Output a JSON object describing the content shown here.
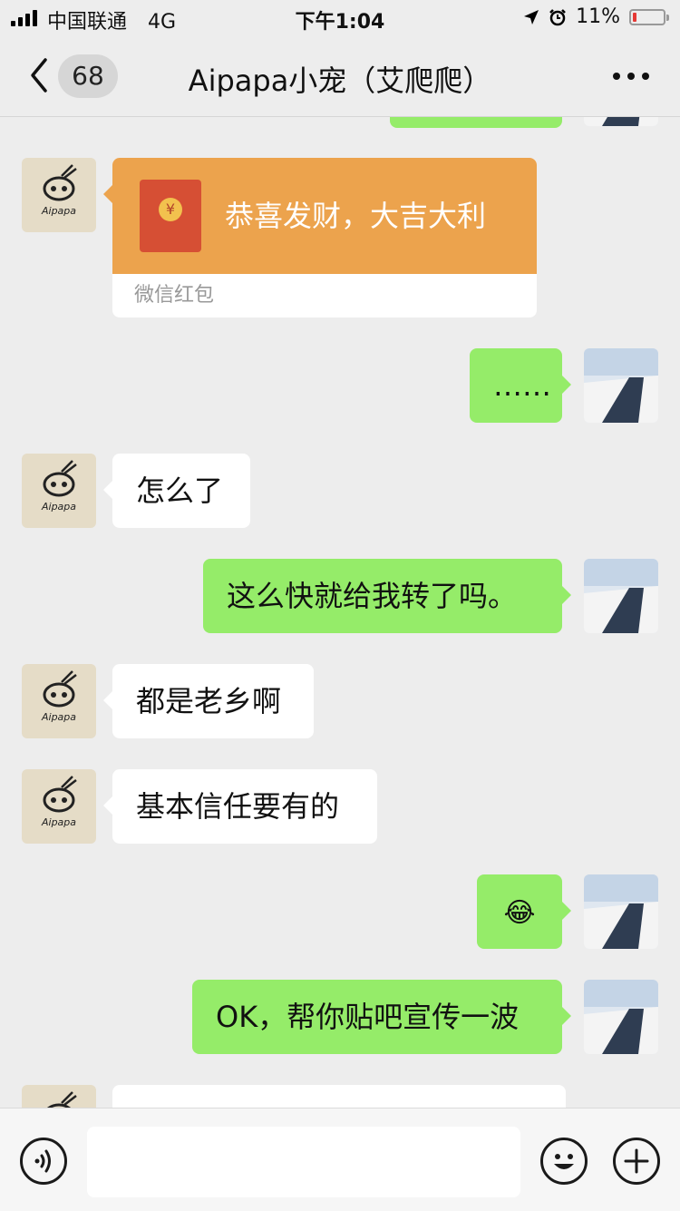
{
  "status_bar": {
    "carrier": "中国联通",
    "network": "4G",
    "time": "下午1:04",
    "battery": "11%",
    "battery_level": 0.11
  },
  "nav": {
    "unread_count": "68",
    "title": "Aipapa小宠（艾爬爬）"
  },
  "messages": [
    {
      "side": "in",
      "type": "red_packet",
      "text": "恭喜发财，大吉大利",
      "label": "微信红包",
      "colors": {
        "top": "#eca34d",
        "envelope": "#d64f34"
      }
    },
    {
      "side": "out",
      "type": "text",
      "text": "……"
    },
    {
      "side": "in",
      "type": "text",
      "text": "怎么了"
    },
    {
      "side": "out",
      "type": "text",
      "text": "这么快就给我转了吗。"
    },
    {
      "side": "in",
      "type": "text",
      "text": "都是老乡啊"
    },
    {
      "side": "in",
      "type": "text",
      "text": "基本信任要有的"
    },
    {
      "side": "out",
      "type": "emoji",
      "text": "😂"
    },
    {
      "side": "out",
      "type": "text",
      "text": "OK，帮你贴吧宣传一波"
    }
  ],
  "avatar_left": {
    "label": "Aipapa",
    "icon": "aipapa-logo"
  },
  "avatar_right": {
    "icon": "snowy-canal-photo"
  },
  "colors": {
    "bubble_out": "#95ec69",
    "bubble_in": "#ffffff",
    "background": "#ededed"
  },
  "icons": {
    "voice": "voice-icon",
    "emoji": "emoji-icon",
    "plus": "plus-icon",
    "back": "chevron-left-icon",
    "more": "more-icon"
  }
}
